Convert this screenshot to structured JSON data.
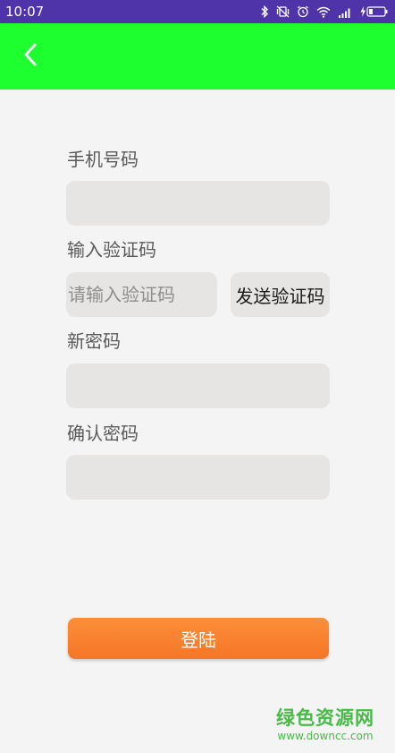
{
  "status_bar": {
    "time": "10:07",
    "icons": [
      "bluetooth-icon",
      "vibrate-off-icon",
      "alarm-icon",
      "wifi-icon",
      "signal-icon",
      "battery-charging-icon"
    ]
  },
  "header": {
    "back_icon": "chevron-left-icon",
    "background_color": "#1dff2e"
  },
  "form": {
    "phone_label": "手机号码",
    "phone_value": "",
    "code_label": "输入验证码",
    "code_placeholder": "请输入验证码",
    "code_value": "",
    "send_code_label": "发送验证码",
    "new_password_label": "新密码",
    "new_password_value": "",
    "confirm_password_label": "确认密码",
    "confirm_password_value": "",
    "login_label": "登陆"
  },
  "watermark": {
    "title": "绿色资源网",
    "url": "www.downcc.com"
  },
  "colors": {
    "status_bar": "#4e34a8",
    "accent": "#f57627",
    "field": "#e6e5e3",
    "background": "#f4f4f4"
  }
}
